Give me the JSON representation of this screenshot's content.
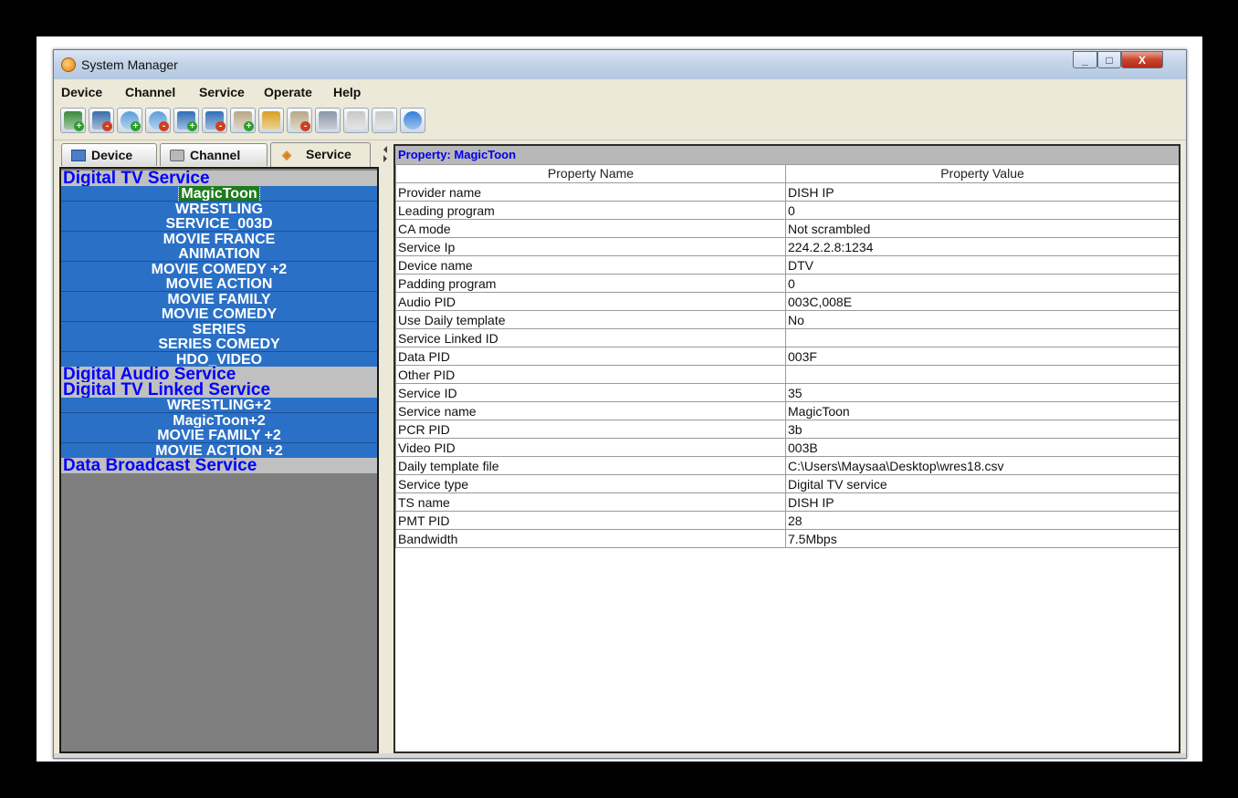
{
  "window": {
    "title": "System Manager",
    "controls": {
      "minimize": "_",
      "maximize": "□",
      "close": "X"
    }
  },
  "menu": [
    "Device",
    "Channel",
    "Service",
    "Operate",
    "Help"
  ],
  "toolbar": {
    "buttons": [
      {
        "icon": "add-device-icon",
        "color": "#3b8a3b",
        "badge": "+",
        "badge_color": "#2e9e2e"
      },
      {
        "icon": "remove-device-icon",
        "color": "#3b6ea8",
        "badge": "-",
        "badge_color": "#d04020"
      },
      {
        "icon": "add-channel-icon",
        "color": "#5a9ed8",
        "badge": "+",
        "badge_color": "#2e9e2e"
      },
      {
        "icon": "remove-channel-icon",
        "color": "#5a9ed8",
        "badge": "-",
        "badge_color": "#d04020"
      },
      {
        "icon": "add-service-icon",
        "color": "#2f6fb5",
        "badge": "+",
        "badge_color": "#2e9e2e"
      },
      {
        "icon": "remove-service-icon",
        "color": "#2f6fb5",
        "badge": "-",
        "badge_color": "#d04020"
      },
      {
        "icon": "add-broadcast-icon",
        "color": "#b8a888",
        "badge": "+",
        "badge_color": "#2e9e2e"
      },
      {
        "icon": "megaphone-icon",
        "color": "#d8a020",
        "badge": "",
        "badge_color": ""
      },
      {
        "icon": "remove-broadcast-icon",
        "color": "#b8a888",
        "badge": "-",
        "badge_color": "#d04020"
      },
      {
        "icon": "printer-icon",
        "color": "#8a96a8",
        "badge": "",
        "badge_color": ""
      },
      {
        "icon": "disabled-gear-icon",
        "color": "#c8c8c8",
        "badge": "",
        "badge_color": ""
      },
      {
        "icon": "disabled-gear-icon",
        "color": "#c8c8c8",
        "badge": "",
        "badge_color": ""
      },
      {
        "icon": "info-icon",
        "color": "#2f7fd8",
        "badge": "",
        "badge_color": ""
      }
    ]
  },
  "tabs": [
    {
      "label": "Device",
      "icon": "monitor-icon",
      "active": false
    },
    {
      "label": "Channel",
      "icon": "router-icon",
      "active": false
    },
    {
      "label": "Service",
      "icon": "rss-icon",
      "active": true
    }
  ],
  "tree": {
    "categories": [
      {
        "label": "Digital TV Service",
        "items": [
          "MagicToon",
          "WRESTLING",
          "SERVICE_003D",
          "MOVIE FRANCE",
          "ANIMATION",
          "MOVIE COMEDY +2",
          "MOVIE ACTION",
          "MOVIE FAMILY",
          "MOVIE COMEDY",
          "SERIES",
          "SERIES COMEDY",
          "HDO_VIDEO"
        ]
      },
      {
        "label": "Digital Audio Service",
        "items": []
      },
      {
        "label": "Digital TV Linked Service",
        "items": [
          "WRESTLING+2",
          "MagicToon+2",
          "MOVIE FAMILY +2",
          "MOVIE ACTION +2"
        ]
      },
      {
        "label": "Data Broadcast Service",
        "items": []
      }
    ],
    "selected": "MagicToon"
  },
  "property": {
    "title": "Property: MagicToon",
    "columns": [
      "Property Name",
      "Property Value"
    ],
    "rows": [
      [
        "Provider name",
        "DISH IP"
      ],
      [
        "Leading program",
        "0"
      ],
      [
        "CA mode",
        "Not scrambled"
      ],
      [
        "Service Ip",
        "224.2.2.8:1234"
      ],
      [
        "Device name",
        "DTV"
      ],
      [
        "Padding program",
        "0"
      ],
      [
        "Audio PID",
        "003C,008E"
      ],
      [
        "Use Daily template",
        "No"
      ],
      [
        "Service Linked ID",
        ""
      ],
      [
        "Data PID",
        "003F"
      ],
      [
        "Other PID",
        ""
      ],
      [
        "Service ID",
        "35"
      ],
      [
        "Service name",
        "MagicToon"
      ],
      [
        "PCR PID",
        "3b"
      ],
      [
        "Video PID",
        "003B"
      ],
      [
        "Daily template file",
        "C:\\Users\\Maysaa\\Desktop\\wres18.csv"
      ],
      [
        "Service type",
        "Digital TV service"
      ],
      [
        "TS name",
        "DISH IP"
      ],
      [
        "PMT PID",
        "28"
      ],
      [
        "Bandwidth",
        "7.5Mbps"
      ]
    ]
  }
}
